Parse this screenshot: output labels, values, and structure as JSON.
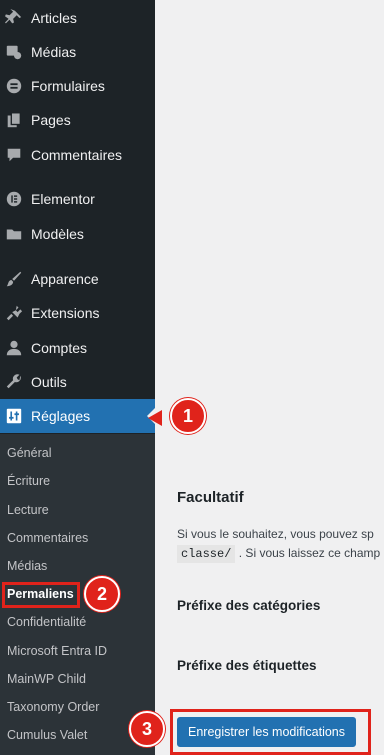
{
  "sidebar": {
    "menu": [
      {
        "label": "Articles",
        "icon": "pin-icon"
      },
      {
        "label": "Médias",
        "icon": "media-icon"
      },
      {
        "label": "Formulaires",
        "icon": "forms-icon"
      },
      {
        "label": "Pages",
        "icon": "pages-icon"
      },
      {
        "label": "Commentaires",
        "icon": "comments-icon"
      },
      {
        "label": "Elementor",
        "icon": "elementor-icon"
      },
      {
        "label": "Modèles",
        "icon": "folder-icon"
      },
      {
        "label": "Apparence",
        "icon": "brush-icon"
      },
      {
        "label": "Extensions",
        "icon": "plugin-icon"
      },
      {
        "label": "Comptes",
        "icon": "user-icon"
      },
      {
        "label": "Outils",
        "icon": "wrench-icon"
      },
      {
        "label": "Réglages",
        "icon": "settings-icon",
        "active": true
      }
    ],
    "submenu": [
      {
        "label": "Général"
      },
      {
        "label": "Écriture"
      },
      {
        "label": "Lecture"
      },
      {
        "label": "Commentaires"
      },
      {
        "label": "Médias"
      },
      {
        "label": "Permaliens",
        "current": true
      },
      {
        "label": "Confidentialité"
      },
      {
        "label": "Microsoft Entra ID"
      },
      {
        "label": "MainWP Child"
      },
      {
        "label": "Taxonomy Order"
      },
      {
        "label": "Cumulus Valet"
      }
    ]
  },
  "main": {
    "section_title": "Facultatif",
    "desc_line1": "Si vous le souhaitez, vous pouvez sp",
    "desc_code": "classe/",
    "desc_line2": ". Si vous laissez ce champ",
    "category_base_label": "Préfixe des catégories",
    "tag_base_label": "Préfixe des étiquettes",
    "save_button": "Enregistrer les modifications"
  },
  "annotations": {
    "step1": "1",
    "step2": "2",
    "step3": "3"
  },
  "colors": {
    "sidebar_bg": "#1d2327",
    "submenu_bg": "#2c3338",
    "accent": "#2271b1",
    "callout": "#e0231b"
  }
}
